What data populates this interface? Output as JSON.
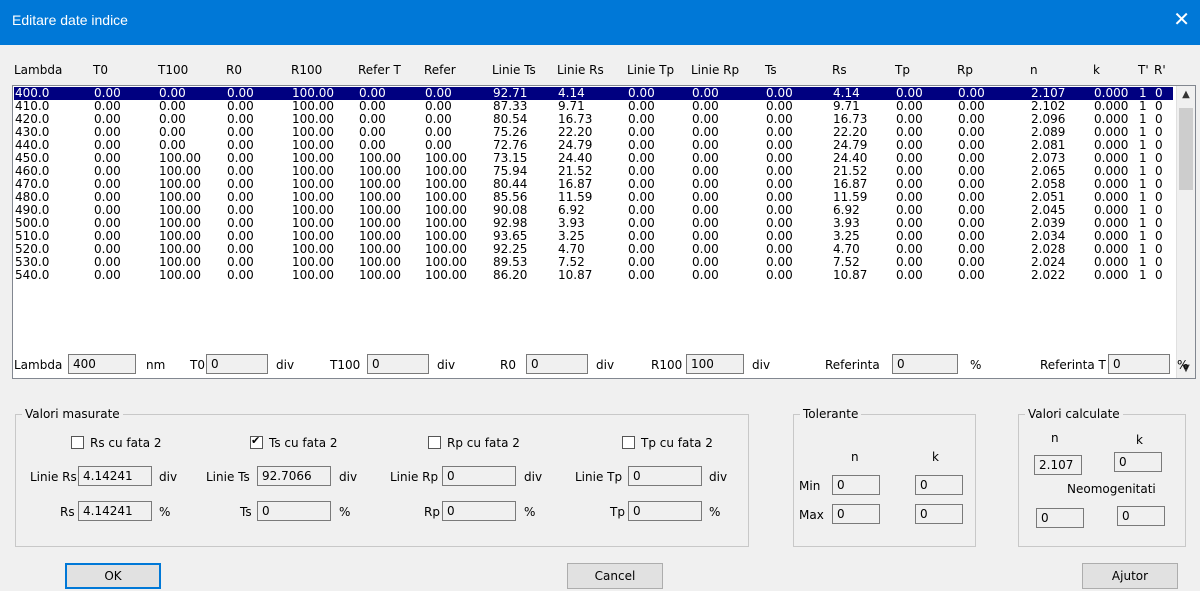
{
  "window": {
    "title": "Editare date indice",
    "close_glyph": "✕"
  },
  "columns": [
    "Lambda",
    "T0",
    "T100",
    "R0",
    "R100",
    "Refer T",
    "Refer",
    "Linie Ts",
    "Linie Rs",
    "Linie Tp",
    "Linie Rp",
    "Ts",
    "Rs",
    "Tp",
    "Rp",
    "n",
    "k",
    "T'",
    "R'"
  ],
  "rows": [
    [
      "400.0",
      "0.00",
      "0.00",
      "0.00",
      "100.00",
      "0.00",
      "0.00",
      "92.71",
      "4.14",
      "0.00",
      "0.00",
      "0.00",
      "4.14",
      "0.00",
      "0.00",
      "2.107",
      "0.000",
      "1",
      "0"
    ],
    [
      "410.0",
      "0.00",
      "0.00",
      "0.00",
      "100.00",
      "0.00",
      "0.00",
      "87.33",
      "9.71",
      "0.00",
      "0.00",
      "0.00",
      "9.71",
      "0.00",
      "0.00",
      "2.102",
      "0.000",
      "1",
      "0"
    ],
    [
      "420.0",
      "0.00",
      "0.00",
      "0.00",
      "100.00",
      "0.00",
      "0.00",
      "80.54",
      "16.73",
      "0.00",
      "0.00",
      "0.00",
      "16.73",
      "0.00",
      "0.00",
      "2.096",
      "0.000",
      "1",
      "0"
    ],
    [
      "430.0",
      "0.00",
      "0.00",
      "0.00",
      "100.00",
      "0.00",
      "0.00",
      "75.26",
      "22.20",
      "0.00",
      "0.00",
      "0.00",
      "22.20",
      "0.00",
      "0.00",
      "2.089",
      "0.000",
      "1",
      "0"
    ],
    [
      "440.0",
      "0.00",
      "0.00",
      "0.00",
      "100.00",
      "0.00",
      "0.00",
      "72.76",
      "24.79",
      "0.00",
      "0.00",
      "0.00",
      "24.79",
      "0.00",
      "0.00",
      "2.081",
      "0.000",
      "1",
      "0"
    ],
    [
      "450.0",
      "0.00",
      "100.00",
      "0.00",
      "100.00",
      "100.00",
      "100.00",
      "73.15",
      "24.40",
      "0.00",
      "0.00",
      "0.00",
      "24.40",
      "0.00",
      "0.00",
      "2.073",
      "0.000",
      "1",
      "0"
    ],
    [
      "460.0",
      "0.00",
      "100.00",
      "0.00",
      "100.00",
      "100.00",
      "100.00",
      "75.94",
      "21.52",
      "0.00",
      "0.00",
      "0.00",
      "21.52",
      "0.00",
      "0.00",
      "2.065",
      "0.000",
      "1",
      "0"
    ],
    [
      "470.0",
      "0.00",
      "100.00",
      "0.00",
      "100.00",
      "100.00",
      "100.00",
      "80.44",
      "16.87",
      "0.00",
      "0.00",
      "0.00",
      "16.87",
      "0.00",
      "0.00",
      "2.058",
      "0.000",
      "1",
      "0"
    ],
    [
      "480.0",
      "0.00",
      "100.00",
      "0.00",
      "100.00",
      "100.00",
      "100.00",
      "85.56",
      "11.59",
      "0.00",
      "0.00",
      "0.00",
      "11.59",
      "0.00",
      "0.00",
      "2.051",
      "0.000",
      "1",
      "0"
    ],
    [
      "490.0",
      "0.00",
      "100.00",
      "0.00",
      "100.00",
      "100.00",
      "100.00",
      "90.08",
      "6.92",
      "0.00",
      "0.00",
      "0.00",
      "6.92",
      "0.00",
      "0.00",
      "2.045",
      "0.000",
      "1",
      "0"
    ],
    [
      "500.0",
      "0.00",
      "100.00",
      "0.00",
      "100.00",
      "100.00",
      "100.00",
      "92.98",
      "3.93",
      "0.00",
      "0.00",
      "0.00",
      "3.93",
      "0.00",
      "0.00",
      "2.039",
      "0.000",
      "1",
      "0"
    ],
    [
      "510.0",
      "0.00",
      "100.00",
      "0.00",
      "100.00",
      "100.00",
      "100.00",
      "93.65",
      "3.25",
      "0.00",
      "0.00",
      "0.00",
      "3.25",
      "0.00",
      "0.00",
      "2.034",
      "0.000",
      "1",
      "0"
    ],
    [
      "520.0",
      "0.00",
      "100.00",
      "0.00",
      "100.00",
      "100.00",
      "100.00",
      "92.25",
      "4.70",
      "0.00",
      "0.00",
      "0.00",
      "4.70",
      "0.00",
      "0.00",
      "2.028",
      "0.000",
      "1",
      "0"
    ],
    [
      "530.0",
      "0.00",
      "100.00",
      "0.00",
      "100.00",
      "100.00",
      "100.00",
      "89.53",
      "7.52",
      "0.00",
      "0.00",
      "0.00",
      "7.52",
      "0.00",
      "0.00",
      "2.024",
      "0.000",
      "1",
      "0"
    ],
    [
      "540.0",
      "0.00",
      "100.00",
      "0.00",
      "100.00",
      "100.00",
      "100.00",
      "86.20",
      "10.87",
      "0.00",
      "0.00",
      "0.00",
      "10.87",
      "0.00",
      "0.00",
      "2.022",
      "0.000",
      "1",
      "0"
    ]
  ],
  "edit": {
    "lambda_label": "Lambda",
    "lambda_value": "400",
    "lambda_unit": "nm",
    "t0_label": "T0",
    "t0_value": "0",
    "t0_unit": "div",
    "t100_label": "T100",
    "t100_value": "0",
    "t100_unit": "div",
    "r0_label": "R0",
    "r0_value": "0",
    "r0_unit": "div",
    "r100_label": "R100",
    "r100_value": "100",
    "r100_unit": "div",
    "ref_label": "Referinta",
    "ref_value": "0",
    "ref_unit": "%",
    "reft_label": "Referinta T",
    "reft_value": "0",
    "reft_unit": "%"
  },
  "measured": {
    "title": "Valori masurate",
    "checks": [
      {
        "label": "Rs cu fata 2",
        "checked": false
      },
      {
        "label": "Ts cu fata 2",
        "checked": true
      },
      {
        "label": "Rp cu fata 2",
        "checked": false
      },
      {
        "label": "Tp cu fata 2",
        "checked": false
      }
    ],
    "linie_rs_label": "Linie Rs",
    "linie_rs_value": "4.14241",
    "linie_rs_unit": "div",
    "linie_ts_label": "Linie Ts",
    "linie_ts_value": "92.7066",
    "linie_ts_unit": "div",
    "linie_rp_label": "Linie Rp",
    "linie_rp_value": "0",
    "linie_rp_unit": "div",
    "linie_tp_label": "Linie Tp",
    "linie_tp_value": "0",
    "linie_tp_unit": "div",
    "rs_label": "Rs",
    "rs_value": "4.14241",
    "rs_unit": "%",
    "ts_label": "Ts",
    "ts_value": "0",
    "ts_unit": "%",
    "rp_label": "Rp",
    "rp_value": "0",
    "rp_unit": "%",
    "tp_label": "Tp",
    "tp_value": "0",
    "tp_unit": "%"
  },
  "tolerante": {
    "title": "Tolerante",
    "n_label": "n",
    "k_label": "k",
    "min_label": "Min",
    "min_n": "0",
    "min_k": "0",
    "max_label": "Max",
    "max_n": "0",
    "max_k": "0"
  },
  "calculate": {
    "title": "Valori calculate",
    "n_label": "n",
    "k_label": "k",
    "n_value": "2.107",
    "k_value": "0",
    "neo_label": "Neomogenitati",
    "neo_1": "0",
    "neo_2": "0"
  },
  "buttons": {
    "ok": "OK",
    "cancel": "Cancel",
    "help": "Ajutor"
  },
  "colors": {
    "titlebar": "#0078d7",
    "selection": "#000080",
    "dialog_bg": "#f0f0f0"
  }
}
